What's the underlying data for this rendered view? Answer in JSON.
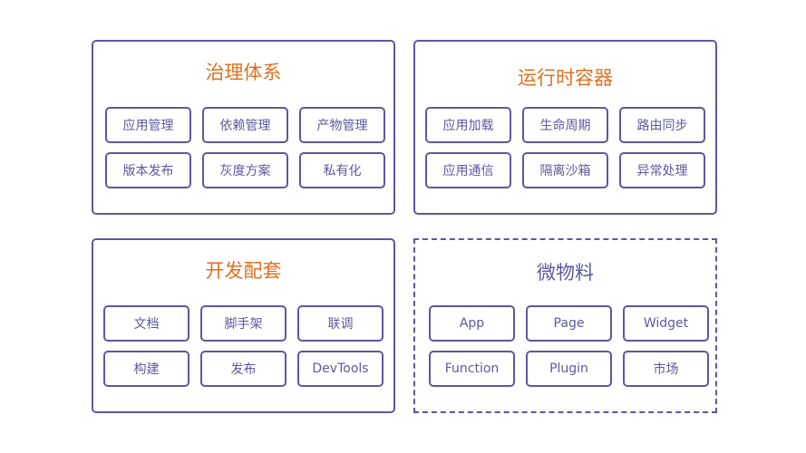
{
  "colors": {
    "border": "#5e57a0",
    "title_orange": "#e07020",
    "text": "#5e57a0"
  },
  "panels": [
    {
      "title": "治理体系",
      "items": [
        "应用管理",
        "依赖管理",
        "产物管理",
        "版本发布",
        "灰度方案",
        "私有化"
      ]
    },
    {
      "title": "运行时容器",
      "items": [
        "应用加载",
        "生命周期",
        "路由同步",
        "应用通信",
        "隔离沙箱",
        "异常处理"
      ]
    },
    {
      "title": "开发配套",
      "items": [
        "文档",
        "脚手架",
        "联调",
        "构建",
        "发布",
        "DevTools"
      ]
    },
    {
      "title": "微物料",
      "items": [
        "App",
        "Page",
        "Widget",
        "Function",
        "Plugin",
        "市场"
      ]
    }
  ]
}
